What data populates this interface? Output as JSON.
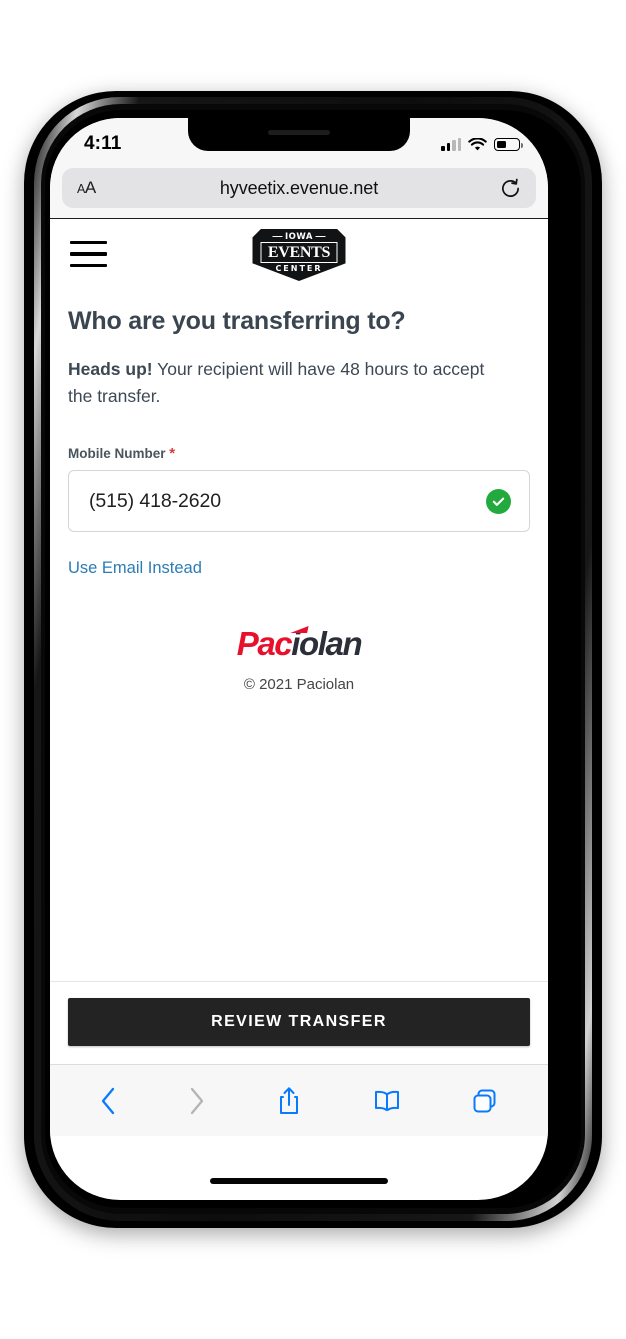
{
  "status_bar": {
    "time": "4:11",
    "cellular_icon": "cellular-signal-icon",
    "wifi_icon": "wifi-icon",
    "battery_icon": "battery-icon",
    "battery_level_percent": 45,
    "signal_bars_filled": 2,
    "signal_bars_total": 4
  },
  "browser": {
    "text_size_button": "AA",
    "url": "hyveetix.evenue.net",
    "reload_icon": "reload-icon",
    "toolbar": {
      "back_icon": "back-chevron-icon",
      "back_enabled": false,
      "forward_icon": "forward-chevron-icon",
      "forward_enabled": false,
      "share_icon": "share-icon",
      "bookmarks_icon": "book-icon",
      "tabs_icon": "tabs-icon",
      "accent_color": "#087aff",
      "disabled_color": "#b4b4b4"
    }
  },
  "site_header": {
    "menu_icon": "hamburger-menu-icon",
    "logo": {
      "name": "iowa-events-center-logo",
      "top_text": "IOWA",
      "middle_text": "EVENTS",
      "bottom_text": "CENTER"
    }
  },
  "main": {
    "title": "Who are you transferring to?",
    "notice_bold": "Heads up!",
    "notice_rest": " Your recipient will have 48 hours to accept the transfer.",
    "form": {
      "label": "Mobile Number",
      "required_marker": "*",
      "value": "(515) 418-2620",
      "placeholder": "Mobile Number",
      "validation_icon": "check-circle-icon",
      "validation_color": "#23aa3e",
      "alt_link": "Use Email Instead",
      "link_color": "#2b7cb5"
    }
  },
  "footer": {
    "brand_part_1": "Pac",
    "brand_part_2": "iolan",
    "brand_color_1": "#e8112d",
    "brand_color_2": "#2b2f38",
    "copyright": "© 2021 Paciolan"
  },
  "cta": {
    "label": "REVIEW TRANSFER",
    "background": "#232323",
    "text_color": "#ffffff"
  }
}
